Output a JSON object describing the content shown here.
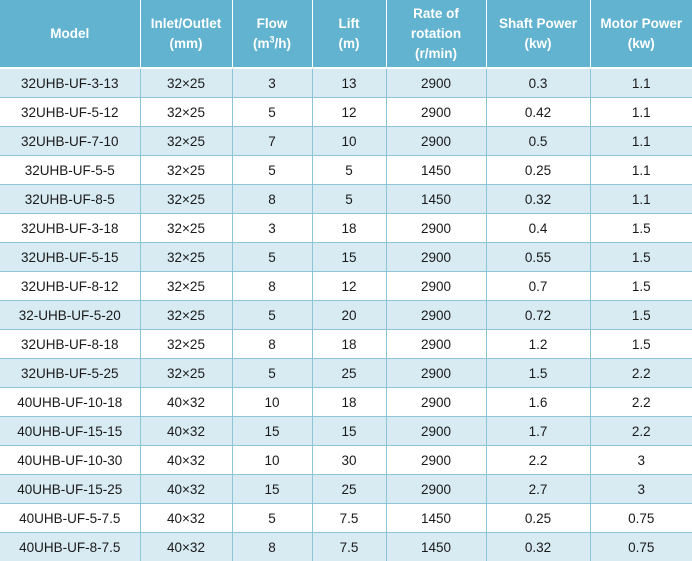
{
  "table": {
    "headers": [
      {
        "line1": "Model",
        "line2": ""
      },
      {
        "line1": "Inlet/Outlet",
        "line2": "(mm)"
      },
      {
        "line1": "Flow",
        "line2_pre": "(m",
        "line2_sup": "3",
        "line2_post": "/h)"
      },
      {
        "line1": "Lift",
        "line2": "(m)"
      },
      {
        "line1": "Rate of",
        "line2": "rotation",
        "line3": "(r/min)"
      },
      {
        "line1": "Shaft Power",
        "line2": "(kw)"
      },
      {
        "line1": "Motor Power",
        "line2": "(kw)"
      }
    ],
    "rows": [
      [
        "32UHB-UF-3-13",
        "32×25",
        "3",
        "13",
        "2900",
        "0.3",
        "1.1"
      ],
      [
        "32UHB-UF-5-12",
        "32×25",
        "5",
        "12",
        "2900",
        "0.42",
        "1.1"
      ],
      [
        "32UHB-UF-7-10",
        "32×25",
        "7",
        "10",
        "2900",
        "0.5",
        "1.1"
      ],
      [
        "32UHB-UF-5-5",
        "32×25",
        "5",
        "5",
        "1450",
        "0.25",
        "1.1"
      ],
      [
        "32UHB-UF-8-5",
        "32×25",
        "8",
        "5",
        "1450",
        "0.32",
        "1.1"
      ],
      [
        "32UHB-UF-3-18",
        "32×25",
        "3",
        "18",
        "2900",
        "0.4",
        "1.5"
      ],
      [
        "32UHB-UF-5-15",
        "32×25",
        "5",
        "15",
        "2900",
        "0.55",
        "1.5"
      ],
      [
        "32UHB-UF-8-12",
        "32×25",
        "8",
        "12",
        "2900",
        "0.7",
        "1.5"
      ],
      [
        "32-UHB-UF-5-20",
        "32×25",
        "5",
        "20",
        "2900",
        "0.72",
        "1.5"
      ],
      [
        "32UHB-UF-8-18",
        "32×25",
        "8",
        "18",
        "2900",
        "1.2",
        "1.5"
      ],
      [
        "32UHB-UF-5-25",
        "32×25",
        "5",
        "25",
        "2900",
        "1.5",
        "2.2"
      ],
      [
        "40UHB-UF-10-18",
        "40×32",
        "10",
        "18",
        "2900",
        "1.6",
        "2.2"
      ],
      [
        "40UHB-UF-15-15",
        "40×32",
        "15",
        "15",
        "2900",
        "1.7",
        "2.2"
      ],
      [
        "40UHB-UF-10-30",
        "40×32",
        "10",
        "30",
        "2900",
        "2.2",
        "3"
      ],
      [
        "40UHB-UF-15-25",
        "40×32",
        "15",
        "25",
        "2900",
        "2.7",
        "3"
      ],
      [
        "40UHB-UF-5-7.5",
        "40×32",
        "5",
        "7.5",
        "1450",
        "0.25",
        "0.75"
      ],
      [
        "40UHB-UF-8-7.5",
        "40×32",
        "8",
        "7.5",
        "1450",
        "0.32",
        "0.75"
      ]
    ]
  },
  "colors": {
    "header_bg": "#62b3cf",
    "row_alt_bg": "#d8ebf3",
    "row_bg": "#ffffff",
    "grid_line": "#8cc4d8"
  }
}
